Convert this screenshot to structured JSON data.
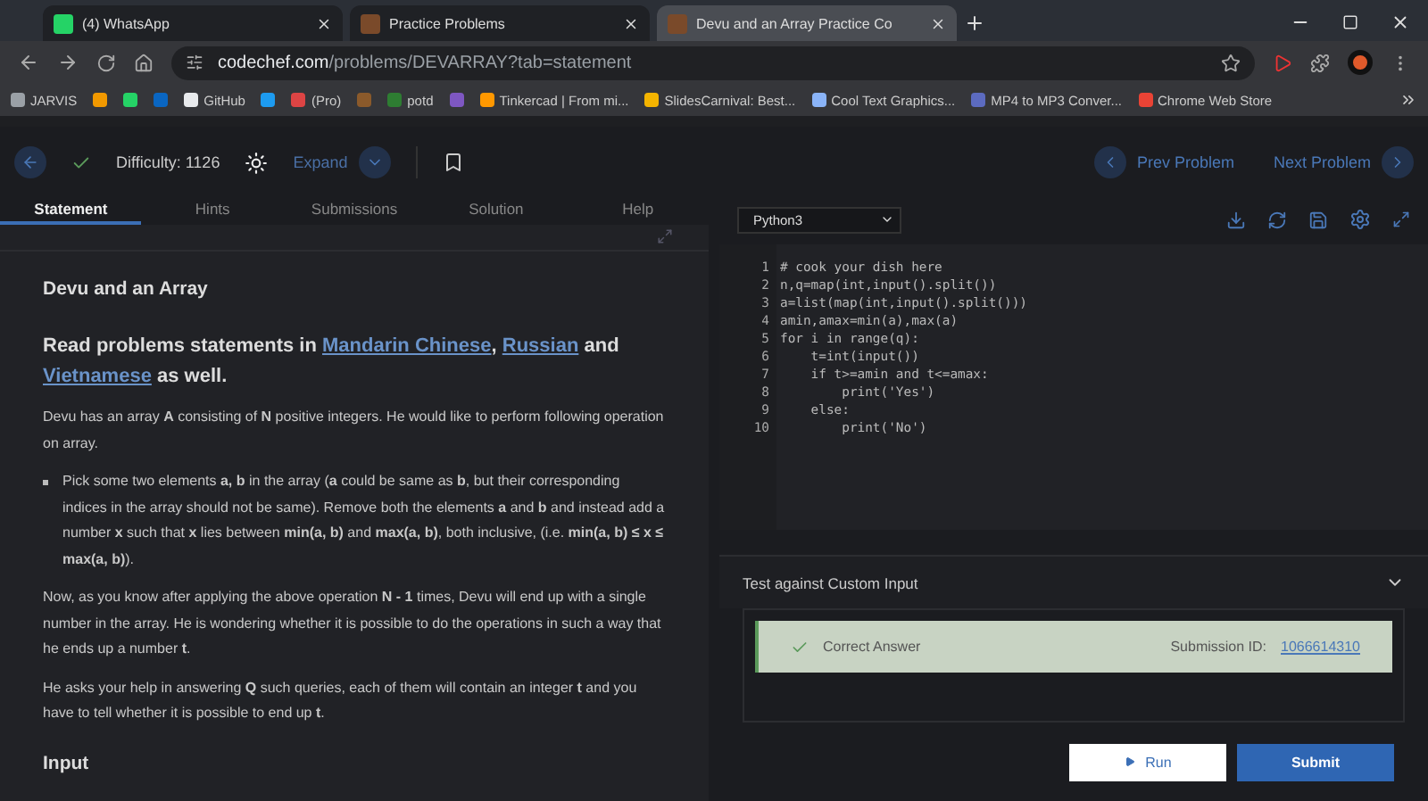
{
  "browser_tabs": [
    {
      "title": "(4) WhatsApp",
      "kind": "whatsapp",
      "selected": false
    },
    {
      "title": "Practice Problems",
      "kind": "codechef",
      "selected": false
    },
    {
      "title": "Devu and an Array Practice Co",
      "kind": "codechef",
      "selected": true
    }
  ],
  "address": {
    "domain": "codechef.com",
    "path": "/problems/DEVARRAY?tab=statement"
  },
  "bookmarks": [
    {
      "label": "JARVIS",
      "color": "#9aa0a6"
    },
    {
      "color": "#f29900"
    },
    {
      "color": "#25d366"
    },
    {
      "color": "#0a66c2"
    },
    {
      "label": "GitHub",
      "color": "#e8eaed"
    },
    {
      "color": "#1d9bf0"
    },
    {
      "label": "(Pro)",
      "color": "#dd4444"
    },
    {
      "color": "#8b5a2b"
    },
    {
      "label": "potd",
      "color": "#2e7d32"
    },
    {
      "color": "#7e57c2"
    },
    {
      "label": "Tinkercad | From mi...",
      "color": "#ff9800"
    },
    {
      "label": "SlidesCarnival: Best...",
      "color": "#f4b400"
    },
    {
      "label": "Cool Text Graphics...",
      "color": "#8ab4f8"
    },
    {
      "label": "MP4 to MP3 Conver...",
      "color": "#5c6bc0"
    },
    {
      "label": "Chrome Web Store",
      "color": "#ea4335"
    }
  ],
  "toolbar": {
    "solved": true,
    "difficulty": "Difficulty: 1126",
    "expand": "Expand",
    "prev": "Prev Problem",
    "next": "Next Problem"
  },
  "problem_tabs": [
    {
      "label": "Statement",
      "selected": true
    },
    {
      "label": "Hints",
      "selected": false
    },
    {
      "label": "Submissions",
      "selected": false
    },
    {
      "label": "Solution",
      "selected": false
    },
    {
      "label": "Help",
      "selected": false
    }
  ],
  "statement": {
    "title": "Devu and an Array",
    "languages": [
      {
        "text": "Read problems statements in ",
        "link": false
      },
      {
        "text": "Mandarin Chinese",
        "link": true
      },
      {
        "text": ", ",
        "link": false
      },
      {
        "text": "Russian",
        "link": true
      },
      {
        "text": " and ",
        "link": false
      },
      {
        "text": "Vietnamese",
        "link": true
      },
      {
        "text": " as well.",
        "link": false
      }
    ],
    "blocks": [
      {
        "kind": "para",
        "text": "Devu has an array **A** consisting of **N** positive integers. He would like to perform following operation on array."
      },
      {
        "kind": "bullet",
        "text": "Pick some two elements **a, b** in the array (**a** could be same as **b**, but their corresponding indices in the array should not be same). Remove both the elements **a** and **b** and instead add a number **x** such that **x** lies between **min(a, b)** and **max(a, b)**, both inclusive, (i.e. **min(a, b) ≤ x ≤ max(a, b)**)."
      },
      {
        "kind": "para",
        "text": "Now, as you know after applying the above operation **N - 1** times, Devu will end up with a single number in the array. He is wondering whether it is possible to do the operations in such a way that he ends up a number **t**."
      },
      {
        "kind": "para",
        "text": "He asks your help in answering **Q** such queries, each of them will contain an integer **t** and you have to tell whether it is possible to end up **t**."
      }
    ],
    "section": "Input"
  },
  "editor": {
    "language": "Python3",
    "lines": [
      {
        "number": "1",
        "code": "# cook your dish here"
      },
      {
        "number": "2",
        "code": "n,q=map(int,input().split())"
      },
      {
        "number": "3",
        "code": "a=list(map(int,input().split()))"
      },
      {
        "number": "4",
        "code": "amin,amax=min(a),max(a)"
      },
      {
        "number": "5",
        "code": "for i in range(q):"
      },
      {
        "number": "6",
        "code": "    t=int(input())"
      },
      {
        "number": "7",
        "code": "    if t>=amin and t<=amax:"
      },
      {
        "number": "8",
        "code": "        print('Yes')"
      },
      {
        "number": "9",
        "code": "    else:"
      },
      {
        "number": "10",
        "code": "        print('No')"
      }
    ]
  },
  "custom_input": {
    "title": "Test against Custom Input",
    "expanded": false
  },
  "result": {
    "status": "Correct Answer",
    "id_label": "Submission ID:",
    "id": "1066614310"
  },
  "buttons": {
    "run": "Run",
    "submit": "Submit"
  }
}
